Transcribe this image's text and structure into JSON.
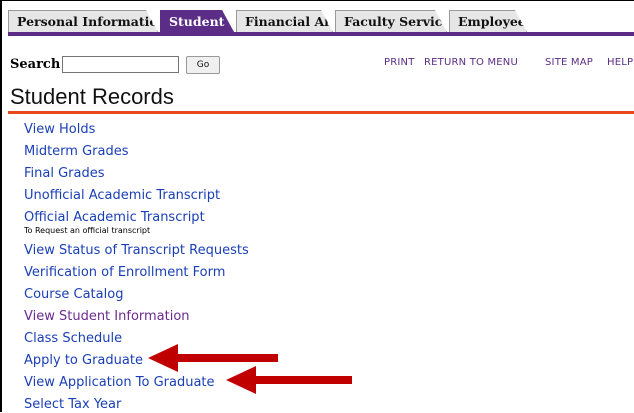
{
  "tabs": [
    "Personal Information",
    "Student",
    "Financial Aid",
    "Faculty Services",
    "Employee"
  ],
  "search": {
    "label": "Search",
    "value": "",
    "go_label": "Go"
  },
  "toplinks": [
    "PRINT",
    "RETURN TO MENU",
    "SITE MAP",
    "HELP"
  ],
  "page_title": "Student Records",
  "menu": [
    {
      "label": "View Holds"
    },
    {
      "label": "Midterm Grades"
    },
    {
      "label": "Final Grades"
    },
    {
      "label": "Unofficial Academic Transcript"
    },
    {
      "label": "Official Academic Transcript",
      "desc": "To Request an official transcript"
    },
    {
      "label": "View Status of Transcript Requests"
    },
    {
      "label": "Verification of Enrollment Form"
    },
    {
      "label": "Course Catalog"
    },
    {
      "label": "View Student Information"
    },
    {
      "label": "Class Schedule"
    },
    {
      "label": "Apply to Graduate"
    },
    {
      "label": "View Application To Graduate"
    },
    {
      "label": "Select Tax Year"
    }
  ],
  "colors": {
    "tab_active": "#5b2d86",
    "title_rule": "#e8481b",
    "link": "#1a3fb5",
    "arrow": "#c00000"
  },
  "icons": [
    "left-arrow-icon",
    "left-arrow-icon"
  ]
}
